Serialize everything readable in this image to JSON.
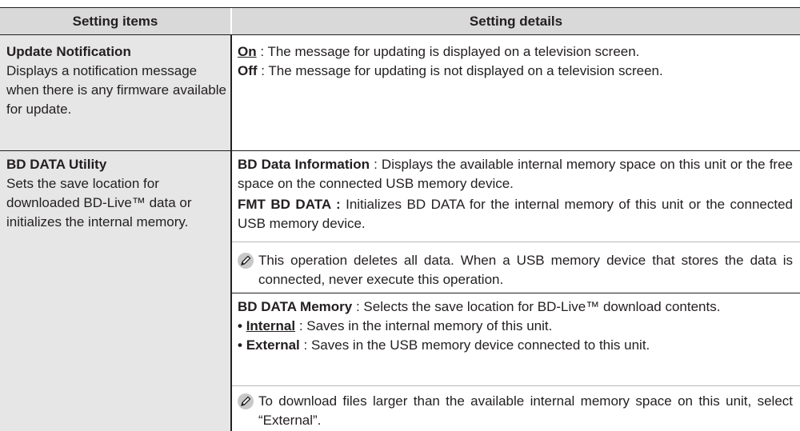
{
  "header": {
    "col1": "Setting items",
    "col2": "Setting details"
  },
  "rows": [
    {
      "title": "Update Notification",
      "desc": "Displays a notification message when there is any firmware available for update.",
      "details": [
        {
          "key": "On",
          "text": " : The message for updating is displayed on a television screen."
        },
        {
          "key": "Off",
          "text": " : The message for updating is not displayed on a television screen."
        }
      ]
    },
    {
      "title": "BD DATA Utility",
      "desc": "Sets the save location for downloaded BD-Live™ data or initializes the internal memory.",
      "block1": {
        "item1_key": "BD Data Information",
        "item1_text": " : Displays the available internal memory space on this unit or the free space on the connected USB memory device.",
        "item2_key": "FMT BD DATA :",
        "item2_text": " Initializes BD DATA for the internal memory of this unit or the connected USB memory device.",
        "note": "This operation deletes all data. When a USB memory device that stores the data is connected, never execute this operation."
      },
      "block2": {
        "key": "BD DATA Memory",
        "text": " : Selects the save location for BD-Live™ download contents.",
        "options": [
          {
            "key": "Internal",
            "text": " : Saves in the internal memory of this unit."
          },
          {
            "key": "External",
            "text": " : Saves in the USB memory device connected to this unit."
          }
        ],
        "note": "To download files larger than the available internal memory space on this unit, select “External”."
      }
    }
  ],
  "icons": {
    "note": "pencil-note-icon"
  }
}
